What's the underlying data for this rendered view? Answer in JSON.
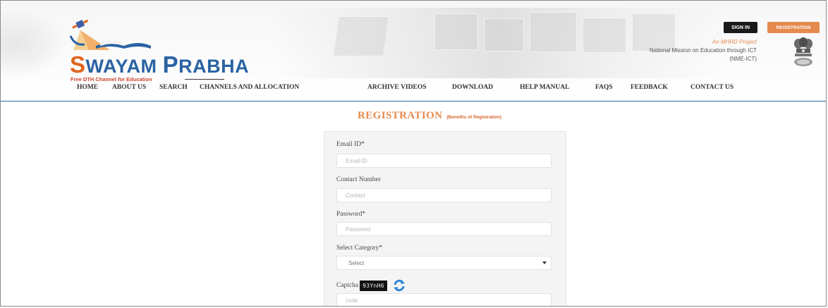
{
  "header": {
    "logo": {
      "title_first_letter": "S",
      "title_word1_rest": "WAYAM ",
      "title_word2_first_letter": "P",
      "title_word2_rest": "RABHA",
      "tagline": "Free DTH Channel for Education"
    },
    "sign_in_label": "SIGN IN",
    "registration_label": "REGISTRATION",
    "mhrd_project": "An MHRD Project",
    "mission_line1": "National Mission on Education through ICT",
    "mission_line2": "(NME-ICT)"
  },
  "nav": {
    "items": [
      {
        "label": "HOME"
      },
      {
        "label": "ABOUT US"
      },
      {
        "label": "SEARCH"
      },
      {
        "label": "CHANNELS AND ALLOCATION"
      },
      {
        "label": "ARCHIVE VIDEOS"
      },
      {
        "label": "DOWNLOAD"
      },
      {
        "label": "HELP MANUAL"
      },
      {
        "label": "FAQS"
      },
      {
        "label": "FEEDBACK"
      },
      {
        "label": "CONTACT US"
      }
    ]
  },
  "main": {
    "title": "REGISTRATION",
    "benefits_link": "(Benefits of Registration)",
    "form": {
      "email_label": "Email ID*",
      "email_placeholder": "Email-ID",
      "contact_label": "Contact Number",
      "contact_placeholder": "Contact",
      "password_label": "Password*",
      "password_placeholder": "Password",
      "category_label": "Select Category*",
      "category_value": "Select",
      "captcha_label": "Captcha",
      "captcha_text": "93YnH6",
      "code_placeholder": "code"
    }
  },
  "colors": {
    "accent_orange": "#e88a4c",
    "brand_blue": "#2a63a3",
    "divider_blue": "#2d6aa6"
  }
}
